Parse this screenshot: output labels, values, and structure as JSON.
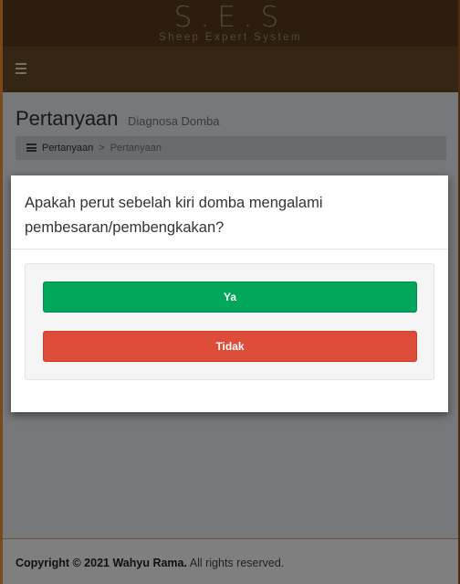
{
  "brand": {
    "title": "S.E.S",
    "subtitle": "Sheep Expert System"
  },
  "navbar": {
    "toggle_icon": "hamburger-menu-icon"
  },
  "header": {
    "title": "Pertanyaan",
    "subtitle": "Diagnosa Domba"
  },
  "breadcrumb": {
    "icon": "list-icon",
    "items": [
      "Pertanyaan",
      "Pertanyaan"
    ],
    "separator": ">"
  },
  "modal": {
    "question": "Apakah perut sebelah kiri domba mengalami pembesaran/pembengkakan?",
    "yes_label": "Ya",
    "no_label": "Tidak"
  },
  "footer": {
    "copyright": "Copyright © 2021 Wahyu Rama.",
    "rights": " All rights reserved."
  },
  "colors": {
    "brand_brown": "#6b4a26",
    "yes_green": "#00a65a",
    "no_red": "#dd4b39"
  }
}
